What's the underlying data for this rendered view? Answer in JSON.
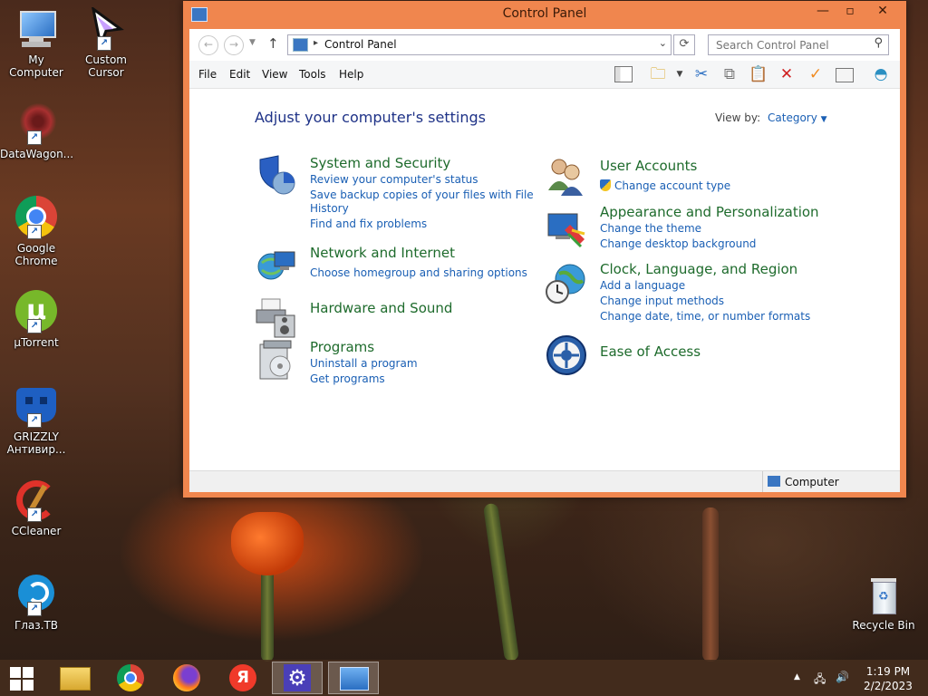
{
  "desktop": {
    "icons": [
      {
        "label": "My Computer"
      },
      {
        "label": "Custom\nCursor"
      },
      {
        "label": "DataWagon..."
      },
      {
        "label": "Google\nChrome"
      },
      {
        "label": "µTorrent"
      },
      {
        "label": "GRIZZLY\nАнтивир..."
      },
      {
        "label": "CCleaner"
      },
      {
        "label": "Глаз.ТВ"
      },
      {
        "label": "Recycle Bin"
      }
    ]
  },
  "window": {
    "title": "Control Panel",
    "address": {
      "crumb": "Control Panel"
    },
    "search": {
      "placeholder": "Search Control Panel"
    },
    "menu": [
      "File",
      "Edit",
      "View",
      "Tools",
      "Help"
    ],
    "heading": "Adjust your computer's settings",
    "view_by": {
      "label": "View by:",
      "value": "Category"
    },
    "categories_left": [
      {
        "title": "System and Security",
        "links": [
          "Review your computer's status",
          "Save backup copies of your files with File",
          "History",
          "Find and fix problems"
        ]
      },
      {
        "title": "Network and Internet",
        "links": [
          "Choose homegroup and sharing options"
        ]
      },
      {
        "title": "Hardware and Sound",
        "links": []
      },
      {
        "title": "Programs",
        "links": [
          "Uninstall a program",
          "Get programs"
        ]
      }
    ],
    "categories_right": [
      {
        "title": "User Accounts",
        "links": [
          "Change account type"
        ]
      },
      {
        "title": "Appearance and Personalization",
        "links": [
          "Change the theme",
          "Change desktop background"
        ]
      },
      {
        "title": "Clock, Language, and Region",
        "links": [
          "Add a language",
          "Change input methods",
          "Change date, time, or number formats"
        ]
      },
      {
        "title": "Ease of Access",
        "links": []
      }
    ],
    "status": "Computer"
  },
  "taskbar": {
    "clock": {
      "time": "1:19 PM",
      "date": "2/2/2023"
    }
  },
  "colors": {
    "window_frame": "#f0864e",
    "link": "#1a5fb4",
    "category_title": "#1e6b2c",
    "heading": "#1e3287"
  }
}
